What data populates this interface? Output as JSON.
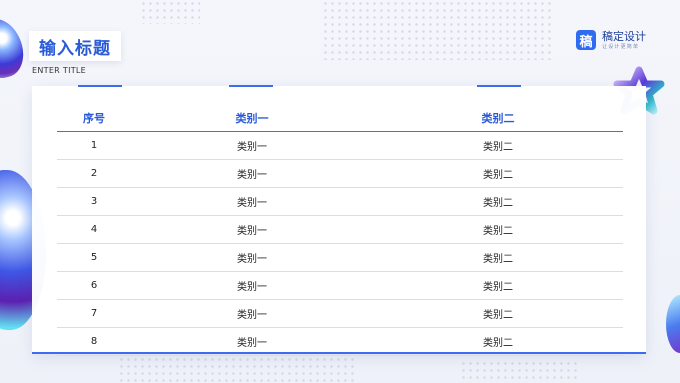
{
  "header": {
    "title": "输入标题",
    "subtitle": "ENTER TITLE"
  },
  "brand": {
    "logo_glyph": "稿",
    "name": "稿定设计",
    "tagline": "让设计更简单"
  },
  "colors": {
    "accent": "#2a5bd7",
    "brand": "#2f6bf0"
  },
  "table": {
    "columns": [
      "序号",
      "类别一",
      "类别二"
    ],
    "rows": [
      [
        "1",
        "类别一",
        "类别二"
      ],
      [
        "2",
        "类别一",
        "类别二"
      ],
      [
        "3",
        "类别一",
        "类别二"
      ],
      [
        "4",
        "类别一",
        "类别二"
      ],
      [
        "5",
        "类别一",
        "类别二"
      ],
      [
        "6",
        "类别一",
        "类别二"
      ],
      [
        "7",
        "类别一",
        "类别二"
      ],
      [
        "8",
        "类别一",
        "类别二"
      ]
    ]
  }
}
